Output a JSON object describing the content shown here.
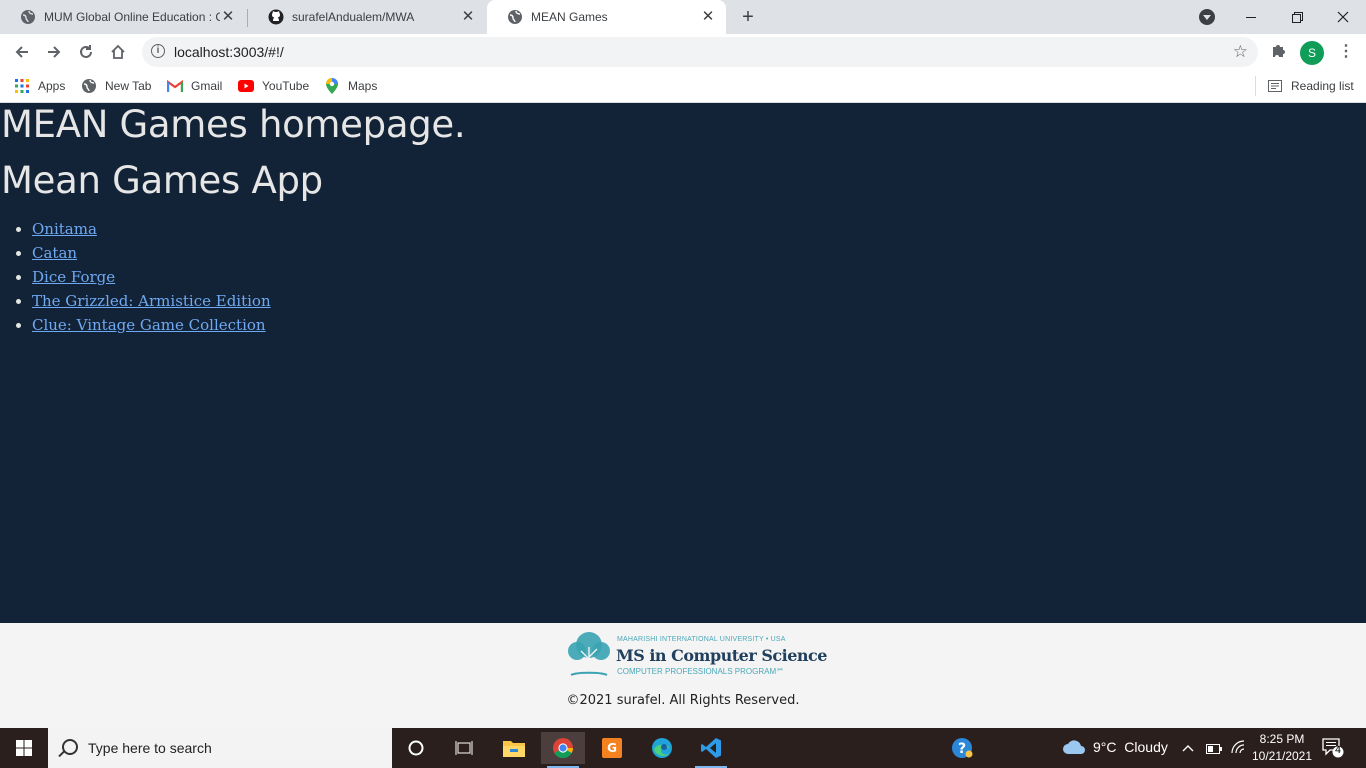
{
  "browser": {
    "tabs": [
      {
        "title": "MUM Global Online Education : C",
        "active": false
      },
      {
        "title": "surafelAndualem/MWA",
        "active": false
      },
      {
        "title": "MEAN Games",
        "active": true
      }
    ],
    "address": "localhost:3003/#!/",
    "profile_initial": "S",
    "bookmarks": [
      {
        "label": "Apps",
        "icon": "apps-grid-icon"
      },
      {
        "label": "New Tab",
        "icon": "globe-icon"
      },
      {
        "label": "Gmail",
        "icon": "gmail-icon"
      },
      {
        "label": "YouTube",
        "icon": "youtube-icon"
      },
      {
        "label": "Maps",
        "icon": "maps-pin-icon"
      }
    ],
    "reading_list": "Reading list"
  },
  "page": {
    "heading": "MEAN Games homepage.",
    "subheading": "Mean Games App",
    "games": [
      "Onitama",
      "Catan",
      "Dice Forge",
      "The Grizzled: Armistice Edition",
      "Clue: Vintage Game Collection"
    ],
    "colors": {
      "background": "#132337",
      "link": "#6fa9f2",
      "text": "#e6e6e6"
    }
  },
  "footer": {
    "logo_line1": "MAHARISHI INTERNATIONAL UNIVERSITY • USA",
    "logo_line2": "MS in Computer Science",
    "logo_line3": "COMPUTER PROFESSIONALS PROGRAM℠",
    "copyright": "©2021 surafel. All Rights Reserved."
  },
  "taskbar": {
    "search_placeholder": "Type here to search",
    "weather": "9°C  Cloudy",
    "time": "8:25 PM",
    "date": "10/21/2021",
    "notifications": "4"
  }
}
